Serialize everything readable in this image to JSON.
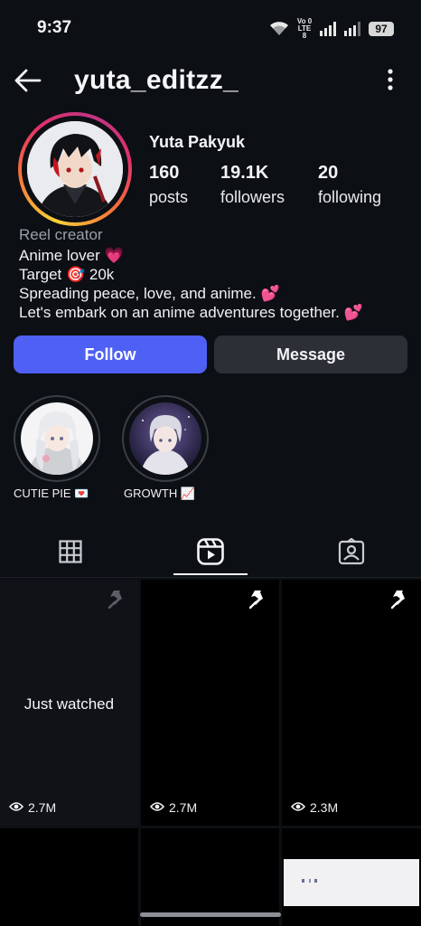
{
  "status": {
    "time": "9:37",
    "network_label_top": "Vo 0",
    "network_label_bottom": "LTE 8",
    "battery": "97"
  },
  "header": {
    "username": "yuta_editzz_"
  },
  "profile": {
    "display_name": "Yuta Pakyuk",
    "stats": [
      {
        "value": "160",
        "label": "posts"
      },
      {
        "value": "19.1K",
        "label": "followers"
      },
      {
        "value": "20",
        "label": "following"
      }
    ],
    "category": "Reel creator",
    "bio": [
      "Anime lover 💗",
      "Target 🎯 20k",
      "Spreading peace, love, and anime. 💕",
      "Let's embark on an anime adventures together. 💕"
    ]
  },
  "actions": {
    "follow": "Follow",
    "message": "Message"
  },
  "highlights": [
    {
      "label": "CUTIE PIE 💌"
    },
    {
      "label": "GROWTH 📈"
    }
  ],
  "tabs": [
    {
      "icon": "grid-icon"
    },
    {
      "icon": "reels-icon",
      "active": true
    },
    {
      "icon": "tagged-icon"
    }
  ],
  "reels": [
    {
      "text": "Just watched",
      "views": "2.7M",
      "pinned": true,
      "pin_color": "#5c5f66"
    },
    {
      "text": "",
      "views": "2.7M",
      "pinned": true,
      "pin_color": "#ffffff"
    },
    {
      "text": "",
      "views": "2.3M",
      "pinned": true,
      "pin_color": "#ffffff"
    },
    {
      "text": "",
      "views": "",
      "pinned": false
    },
    {
      "text": "",
      "views": "",
      "pinned": false
    },
    {
      "text": "",
      "views": "",
      "pinned": false
    }
  ],
  "colors": {
    "background": "#0c0f14",
    "follow": "#4f60f5",
    "message": "#2c2f36",
    "muted": "#9aa0a8"
  }
}
